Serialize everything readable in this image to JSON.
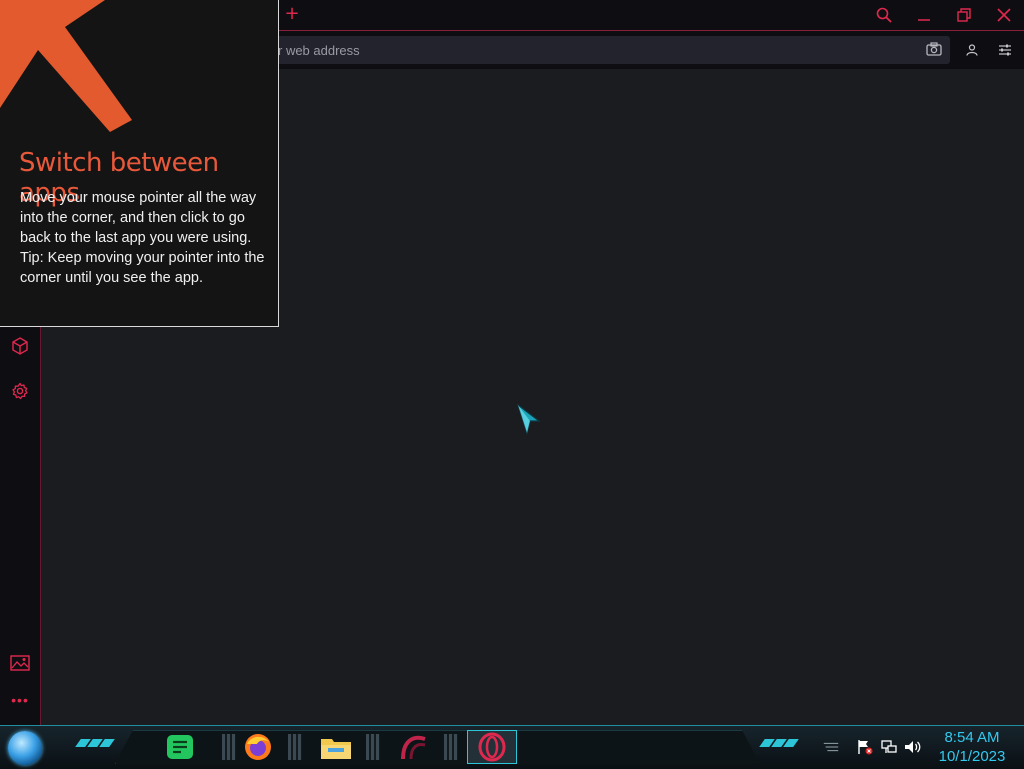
{
  "browser": {
    "new_tab_symbol": "+",
    "address_placeholder": "r web address",
    "window_controls": [
      "search-icon",
      "minimize-icon",
      "restore-icon",
      "close-icon"
    ],
    "address_buttons": [
      "camera-icon",
      "account-icon",
      "settings-sliders-icon"
    ],
    "accent_color": "#e0284f"
  },
  "sidebar": {
    "items": [
      "cube-icon",
      "settings-gear-icon",
      "gallery-icon"
    ],
    "more_label": "•••"
  },
  "tip": {
    "title": "Switch between apps",
    "body": "Move your mouse pointer all the way into the corner, and then click to go back to the last app you were using.",
    "hint": "Tip: Keep moving your pointer into the corner until you see the app.",
    "title_color": "#e8583a"
  },
  "taskbar": {
    "apps": [
      "notes-app-icon",
      "firefox-icon",
      "file-explorer-icon",
      "arc-app-icon",
      "opera-icon"
    ],
    "tray": [
      "show-hidden-icon",
      "action-center-flag-icon",
      "network-icon",
      "volume-icon"
    ],
    "time": "8:54 AM",
    "date": "10/1/2023",
    "clock_color": "#33c9ef"
  }
}
